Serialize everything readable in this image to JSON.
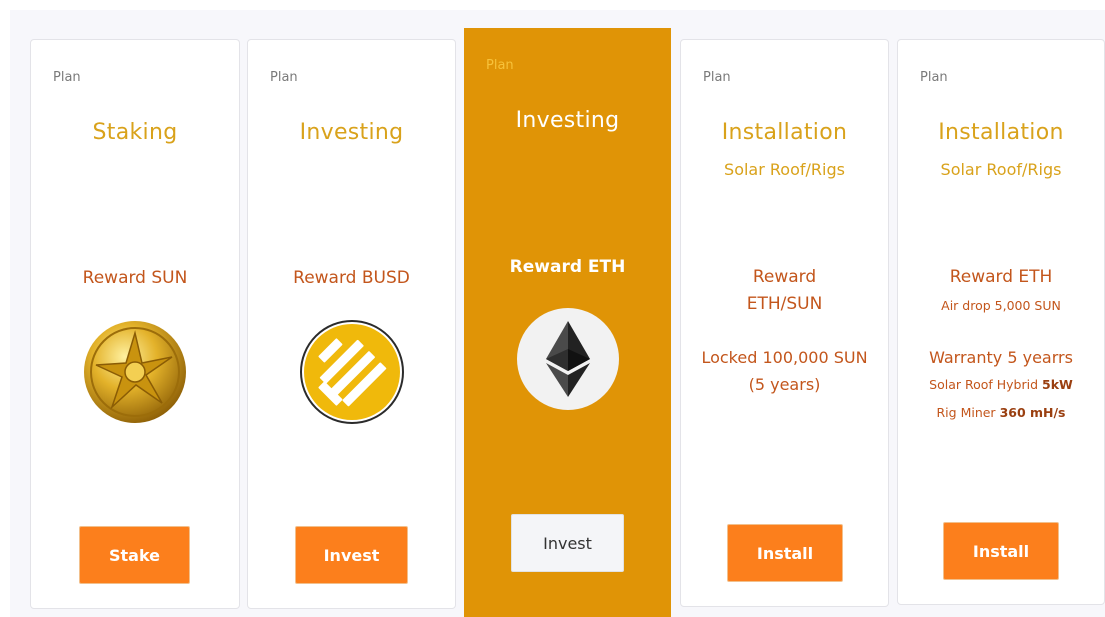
{
  "cards": [
    {
      "plan_label": "Plan",
      "title": "Staking",
      "reward": "Reward SUN",
      "icon": "sun-coin-icon",
      "button": "Stake"
    },
    {
      "plan_label": "Plan",
      "title": "Investing",
      "reward": "Reward BUSD",
      "icon": "busd-coin-icon",
      "button": "Invest"
    },
    {
      "plan_label": "Plan",
      "title": "Investing",
      "reward": "Reward ETH",
      "icon": "ethereum-icon",
      "button": "Invest"
    },
    {
      "plan_label": "Plan",
      "title": "Installation",
      "subtitle": "Solar Roof/Rigs",
      "reward_line1": "Reward",
      "reward_line2": "ETH/SUN",
      "note_line1": "Locked 100,000 SUN",
      "note_line2": "(5 years)",
      "button": "Install"
    },
    {
      "plan_label": "Plan",
      "title": "Installation",
      "subtitle": "Solar Roof/Rigs",
      "reward": "Reward ETH",
      "airdrop": "Air drop 5,000 SUN",
      "warranty": "Warranty 5 yearrs",
      "hybrid_label": "Solar Roof Hybrid",
      "hybrid_value": "5kW",
      "miner_label": "Rig Miner",
      "miner_value": "360 mH/s",
      "button": "Install"
    }
  ],
  "colors": {
    "accent_orange": "#fc7f1c",
    "featured_bg": "#e09406",
    "title_gold": "#d9a21b",
    "reward_rust": "#c3561c"
  }
}
